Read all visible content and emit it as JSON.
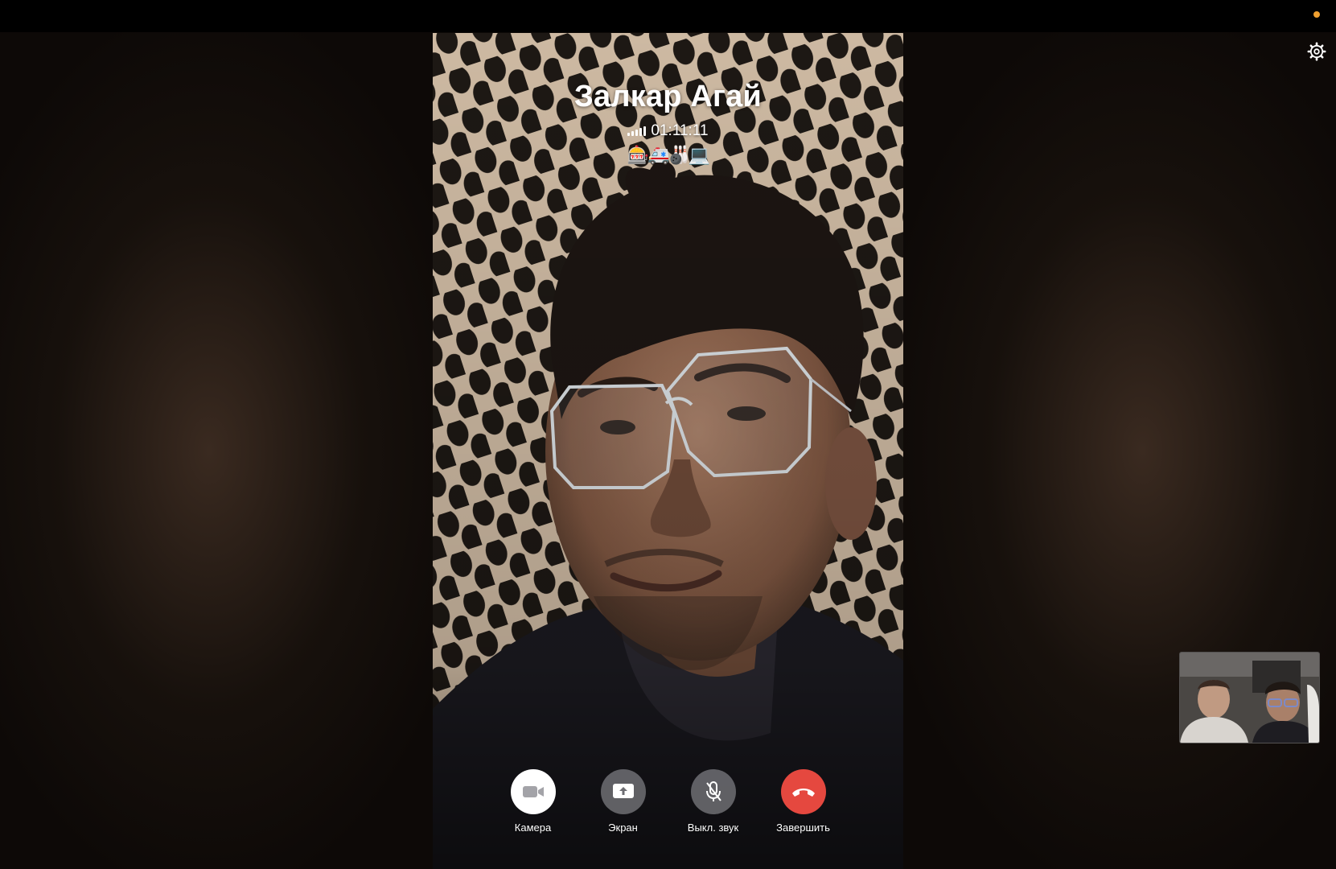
{
  "call": {
    "caller_name": "Залкар Агай",
    "duration": "01:11:11",
    "encryption_emojis": "🎰🚑🎳💻"
  },
  "controls": [
    {
      "label": "Камера",
      "icon": "video-camera-icon"
    },
    {
      "label": "Экран",
      "icon": "screen-share-icon"
    },
    {
      "label": "Выкл. звук",
      "icon": "mic-off-icon"
    },
    {
      "label": "Завершить",
      "icon": "end-call-icon"
    }
  ],
  "colors": {
    "end_call": "#e5483f",
    "indicator": "#f0a030"
  }
}
